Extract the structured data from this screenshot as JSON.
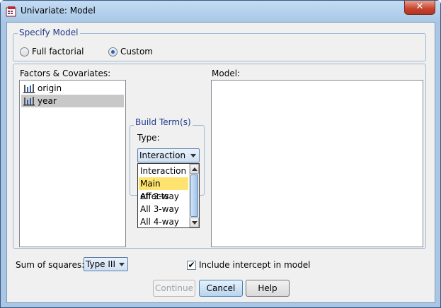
{
  "window": {
    "title": "Univariate: Model",
    "close_label": "✕"
  },
  "specify_model": {
    "label": "Specify Model",
    "full_factorial_label": "Full factorial",
    "custom_label": "Custom",
    "selected": "Custom"
  },
  "factors": {
    "label": "Factors & Covariates:",
    "items": [
      {
        "label": "origin",
        "selected": false
      },
      {
        "label": "year",
        "selected": true
      }
    ]
  },
  "build_terms": {
    "label": "Build Term(s)",
    "type_label": "Type:",
    "selected_type": "Interaction",
    "dropdown_options": [
      "Interaction",
      "Main effects",
      "All 2-way",
      "All 3-way",
      "All 4-way"
    ],
    "highlighted_option": "Main effects"
  },
  "model": {
    "label": "Model:"
  },
  "sum_of_squares": {
    "label": "Sum of squares:",
    "value": "Type III"
  },
  "intercept": {
    "label": "Include intercept in model",
    "checked": true
  },
  "buttons": {
    "continue_label": "Continue",
    "cancel_label": "Cancel",
    "help_label": "Help"
  },
  "colors": {
    "group_label": "#1e3a8c",
    "highlight": "#ffe36f",
    "selection": "#c8c8c8"
  }
}
